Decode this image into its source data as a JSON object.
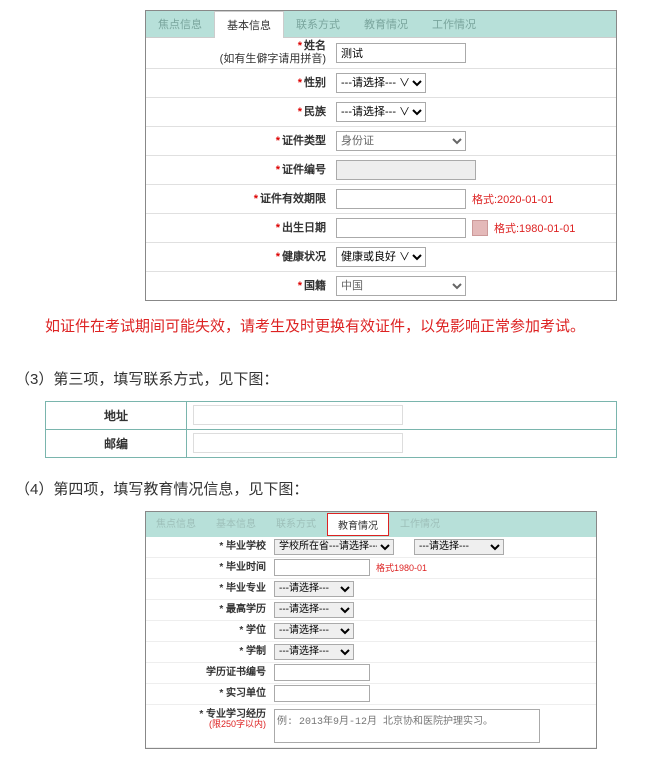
{
  "basic": {
    "tabs": [
      "焦点信息",
      "基本信息",
      "联系方式",
      "教育情况",
      "工作情况"
    ],
    "active_tab": 1,
    "rows": {
      "name_label": "姓名",
      "name_sub": "(如有生僻字请用拼音)",
      "name_value": "测试",
      "gender_label": "性别",
      "gender_value": "---请选择--- ∨",
      "ethnic_label": "民族",
      "ethnic_value": "---请选择--- ∨",
      "id_type_label": "证件类型",
      "id_type_value": "身份证",
      "id_no_label": "证件编号",
      "id_no_value": "",
      "id_valid_label": "证件有效期限",
      "id_valid_value": "",
      "id_valid_hint": "格式:2020-01-01",
      "birth_label": "出生日期",
      "birth_value": "",
      "birth_hint": "格式:1980-01-01",
      "health_label": "健康状况",
      "health_value": "健康或良好 ∨",
      "country_label": "国籍",
      "country_value": "中国"
    }
  },
  "warning_text": "如证件在考试期间可能失效，请考生及时更换有效证件，以免影响正常参加考试。",
  "step3": "（3）第三项，填写联系方式，见下图：",
  "contact": {
    "addr_label": "地址",
    "zip_label": "邮编"
  },
  "step4": "（4）第四项，填写教育情况信息，见下图：",
  "edu": {
    "tabs": [
      "焦点信息",
      "基本信息",
      "联系方式",
      "教育情况",
      "工作情况"
    ],
    "active_tab": 3,
    "school_label": "* 毕业学校",
    "school_text1": "学校所在省---请选择---",
    "school_text2": "---请选择---",
    "grad_time_label": "* 毕业时间",
    "grad_time_hint": "格式1980-01",
    "major_label": "* 毕业专业",
    "major_value": "---请选择---",
    "hdegree_label": "* 最高学历",
    "hdegree_value": "---请选择---",
    "degree_label": "* 学位",
    "degree_value": "---请选择---",
    "system_label": "* 学制",
    "system_value": "---请选择---",
    "cert_label": "学历证书编号",
    "intern_label": "* 实习单位",
    "exp_label": "* 专业学习经历",
    "exp_sub": "(限250字以内)",
    "exp_placeholder": "例: 2013年9月-12月 北京协和医院护理实习。"
  }
}
